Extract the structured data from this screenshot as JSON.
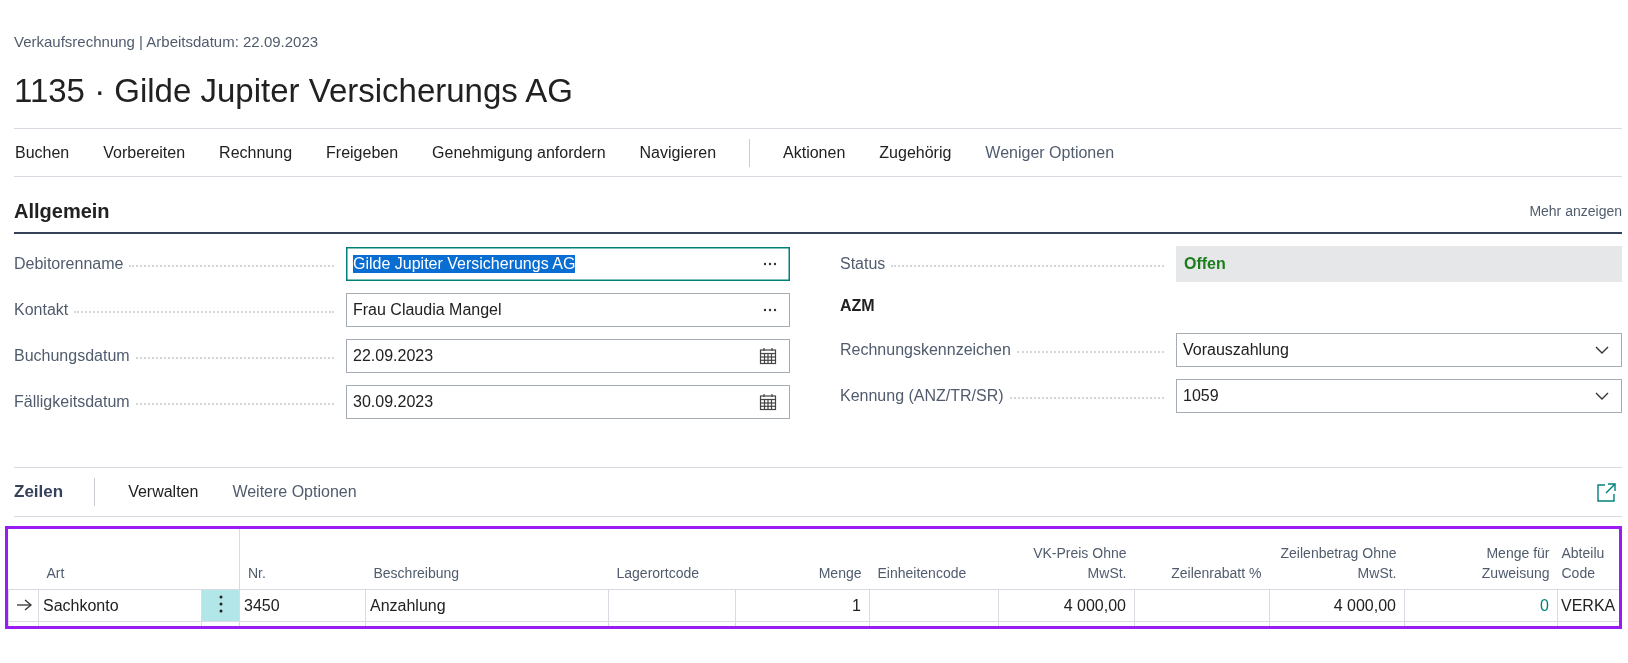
{
  "breadcrumb": "Verkaufsrechnung | Arbeitsdatum: 22.09.2023",
  "title": "1135 · Gilde Jupiter Versicherungs AG",
  "actions": [
    {
      "label": "Buchen",
      "kind": "primary"
    },
    {
      "label": "Vorbereiten",
      "kind": "primary"
    },
    {
      "label": "Rechnung",
      "kind": "primary"
    },
    {
      "label": "Freigeben",
      "kind": "primary"
    },
    {
      "label": "Genehmigung anfordern",
      "kind": "primary"
    },
    {
      "label": "Navigieren",
      "kind": "primary"
    },
    {
      "label": "Aktionen",
      "kind": "secondary"
    },
    {
      "label": "Zugehörig",
      "kind": "secondary"
    },
    {
      "label": "Weniger Optionen",
      "kind": "toggle"
    }
  ],
  "general": {
    "heading": "Allgemein",
    "show_more": "Mehr anzeigen",
    "left_fields": [
      {
        "kind": "lookup",
        "label": "Debitorenname",
        "value": "Gilde Jupiter Versicherungs AG",
        "focused": true
      },
      {
        "kind": "lookup",
        "label": "Kontakt",
        "value": "Frau Claudia Mangel",
        "focused": false
      },
      {
        "kind": "date",
        "label": "Buchungsdatum",
        "value": "22.09.2023",
        "focused": false
      },
      {
        "kind": "date",
        "label": "Fälligkeitsdatum",
        "value": "30.09.2023",
        "focused": false
      }
    ],
    "right_fields": [
      {
        "kind": "status",
        "label": "Status",
        "value": "Offen"
      },
      {
        "kind": "group",
        "label": "AZM"
      },
      {
        "kind": "dropdown",
        "label": "Rechnungskennzeichen",
        "value": "Vorauszahlung"
      },
      {
        "kind": "dropdown",
        "label": "Kennung (ANZ/TR/SR)",
        "value": "1059"
      }
    ]
  },
  "lines": {
    "heading": "Zeilen",
    "actions": [
      {
        "label": "Verwalten",
        "kind": "primary"
      },
      {
        "label": "Weitere Optionen",
        "kind": "toggle"
      }
    ],
    "table": {
      "highlighted": true,
      "columns": [
        {
          "label": "Art",
          "numeric": false
        },
        {
          "label": "Nr.",
          "numeric": false
        },
        {
          "label": "Beschreibung",
          "numeric": false
        },
        {
          "label": "Lagerortcode",
          "numeric": false
        },
        {
          "label": "Menge",
          "numeric": true
        },
        {
          "label": "Einheitencode",
          "numeric": false
        },
        {
          "label": "VK-Preis Ohne MwSt.",
          "numeric": true
        },
        {
          "label": "Zeilenrabatt %",
          "numeric": true
        },
        {
          "label": "Zeilenbetrag Ohne MwSt.",
          "numeric": true
        },
        {
          "label": "Menge für Zuweisung",
          "numeric": true
        },
        {
          "label": "Abteilu Code",
          "numeric": false
        }
      ],
      "rows": [
        {
          "current": true,
          "cells": [
            {
              "kind": "text",
              "value": "Sachkonto"
            },
            {
              "kind": "text",
              "value": "3450"
            },
            {
              "kind": "text",
              "value": "Anzahlung"
            },
            {
              "kind": "empty"
            },
            {
              "kind": "text",
              "value": "1"
            },
            {
              "kind": "empty"
            },
            {
              "kind": "text",
              "value": "4 000,00"
            },
            {
              "kind": "empty"
            },
            {
              "kind": "text",
              "value": "4 000,00"
            },
            {
              "kind": "link",
              "value": "0"
            },
            {
              "kind": "text",
              "value": "VERKA"
            }
          ]
        }
      ]
    }
  }
}
